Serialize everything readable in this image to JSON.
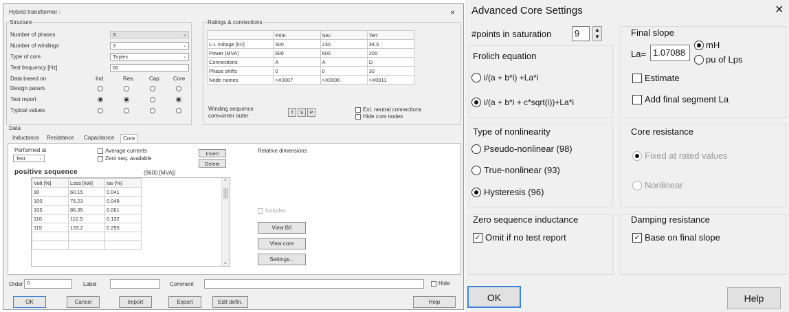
{
  "hybrid": {
    "title": "Hybrid transformer :",
    "close": "×",
    "structure": {
      "heading": "Structure",
      "phases_label": "Number of phases",
      "phases_value": "3",
      "windings_label": "Number of windings",
      "windings_value": "3",
      "core_label": "Type of core",
      "core_value": "Triplex",
      "freq_label": "Test frequency [Hz]",
      "freq_value": "60",
      "databased_label": "Data based on",
      "cols": [
        "Ind.",
        "Res.",
        "Cap.",
        "Core"
      ],
      "rows": [
        {
          "label": "Design param.",
          "sel": [
            false,
            false,
            false,
            false
          ]
        },
        {
          "label": "Test report",
          "sel": [
            true,
            true,
            false,
            true
          ]
        },
        {
          "label": "Typical values",
          "sel": [
            false,
            false,
            false,
            false
          ]
        }
      ]
    },
    "ratings": {
      "heading": "Ratings & connections",
      "header": [
        "",
        "Prim",
        "Sec",
        "Tert"
      ],
      "rows": [
        [
          "L-L voltage [kV]",
          "500",
          "230",
          "34.5"
        ],
        [
          "Power [MVA]",
          "600",
          "600",
          "200"
        ],
        [
          "Connections",
          "A",
          "A",
          "D"
        ],
        [
          "Phase shifts",
          "0",
          "0",
          "30"
        ],
        [
          "Node names",
          ">X0007",
          ">X0006",
          ">X0011"
        ]
      ],
      "winding_seq_label": "Winding sequence",
      "core_outer_label": "core=inner outer",
      "seq_buttons": [
        "T",
        "S",
        "P"
      ],
      "ext_neutral": "Ext. neutral connections",
      "hide_core": "Hide core nodes"
    },
    "data_heading": "Data",
    "tabs": [
      "Inductance",
      "Resistance",
      "Capacitance",
      "Core"
    ],
    "core": {
      "performed_label": "Performed at",
      "performed_value": "Test",
      "avg_currents": "Average currents",
      "zero_seq": "Zero seq. available",
      "insert": "Insert",
      "delete": "Delete",
      "positive": "positive sequence",
      "mva": "(9600 [MVA])",
      "table_header": [
        "Volt [%]",
        "Loss [kW]",
        "Iav [%]"
      ],
      "table_rows": [
        [
          "90",
          "60.15",
          "0.041"
        ],
        [
          "100",
          "76.23",
          "0.048"
        ],
        [
          "105",
          "86.35",
          "0.061"
        ],
        [
          "110",
          "110.9",
          "0.132"
        ],
        [
          "115",
          "133.2",
          "0.295"
        ]
      ],
      "relative_dims": "Relative dimensions",
      "includes": "Includes",
      "view_bh": "View B/I",
      "view_core": "View core",
      "settings": "Settings..."
    },
    "bottom": {
      "order_label": "Order",
      "order_value": "0",
      "label_label": "Label",
      "comment_label": "Comment",
      "hide_label": "Hide"
    },
    "buttons": [
      "OK",
      "Cancel",
      "Import",
      "Export",
      "Edit defin.",
      "Help"
    ]
  },
  "acs": {
    "title": "Advanced Core Settings",
    "close": "×",
    "points_label": "#points in saturation",
    "points_value": "9",
    "frolich_title": "Frolich equation",
    "frolich_opt1": "i/(a + b*i) +La*i",
    "frolich_opt2": "i/(a + b*i + c*sqrt(i))+La*i",
    "final_slope_title": "Final slope",
    "la_label": "La=",
    "la_value": "1.07088",
    "unit_mh": "mH",
    "unit_pu": "pu of Lps",
    "estimate": "Estimate",
    "add_final": "Add final segment La",
    "nonlin_title": "Type of nonlinearity",
    "nonlin_opts": [
      "Pseudo-nonlinear (98)",
      "True-nonlinear (93)",
      "Hysteresis (96)"
    ],
    "core_res_title": "Core resistance",
    "core_res_opts": [
      "Fixed at rated values",
      "Nonlinear"
    ],
    "zero_seq_title": "Zero sequence inductance",
    "omit": "Omit if no test report",
    "damping_title": "Damping resistance",
    "base_final": "Base on final slope",
    "ok": "OK",
    "help": "Help"
  }
}
